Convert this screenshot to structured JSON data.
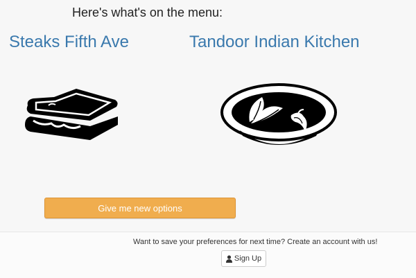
{
  "menu": {
    "heading": "Here's what's on the menu:",
    "restaurants": [
      {
        "name": "Steaks Fifth Ave",
        "icon": "sandwich-icon"
      },
      {
        "name": "Tandoor Indian Kitchen",
        "icon": "curry-bowl-icon"
      }
    ]
  },
  "actions": {
    "new_options_label": "Give me new options"
  },
  "footer": {
    "prompt": "Want to save your preferences for next time? Create an account with us!",
    "signup_label": "Sign Up",
    "signup_icon": "user-icon"
  },
  "colors": {
    "restaurant_name": "#3a79ad",
    "options_button": "#f0ad4e",
    "background": "#f7f7f7"
  }
}
